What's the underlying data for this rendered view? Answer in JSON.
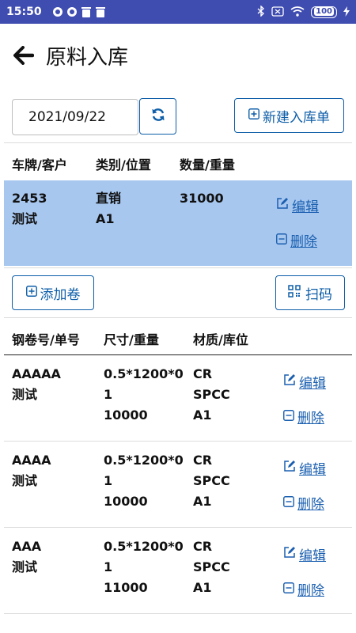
{
  "status_bar": {
    "time": "15:50",
    "battery": "100"
  },
  "header": {
    "title": "原料入库"
  },
  "toolbar": {
    "date_value": "2021/09/22",
    "new_label": "新建入库单"
  },
  "order_table": {
    "columns": [
      "车牌/客户",
      "类别/位置",
      "数量/重量"
    ],
    "row": {
      "plate": "2453",
      "customer": "测试",
      "category": "直销",
      "position": "A1",
      "quantity": "31000",
      "edit_label": "编辑",
      "delete_label": "删除"
    }
  },
  "actions": {
    "add_label": "添加卷",
    "scan_label": "扫码"
  },
  "coil_table": {
    "columns": [
      "钢卷号/单号",
      "尺寸/重量",
      "材质/库位"
    ],
    "rows": [
      {
        "coil_no": "AAAAA",
        "order_no": "测试",
        "size_line1": "0.5*1200*0",
        "size_line2": "1",
        "weight": "10000",
        "material": "CR",
        "grade": "SPCC",
        "location": "A1",
        "edit_label": "编辑",
        "delete_label": "删除"
      },
      {
        "coil_no": "AAAA",
        "order_no": "测试",
        "size_line1": "0.5*1200*0",
        "size_line2": "1",
        "weight": "10000",
        "material": "CR",
        "grade": "SPCC",
        "location": "A1",
        "edit_label": "编辑",
        "delete_label": "删除"
      },
      {
        "coil_no": "AAA",
        "order_no": "测试",
        "size_line1": "0.5*1200*0",
        "size_line2": "1",
        "weight": "11000",
        "material": "CR",
        "grade": "SPCC",
        "location": "A1",
        "edit_label": "编辑",
        "delete_label": "删除"
      }
    ]
  },
  "colors": {
    "status_bar": "#3f4cb0",
    "accent": "#0e5ea8",
    "link": "#1a5fb0",
    "selected_row": "#a7c7ef"
  }
}
